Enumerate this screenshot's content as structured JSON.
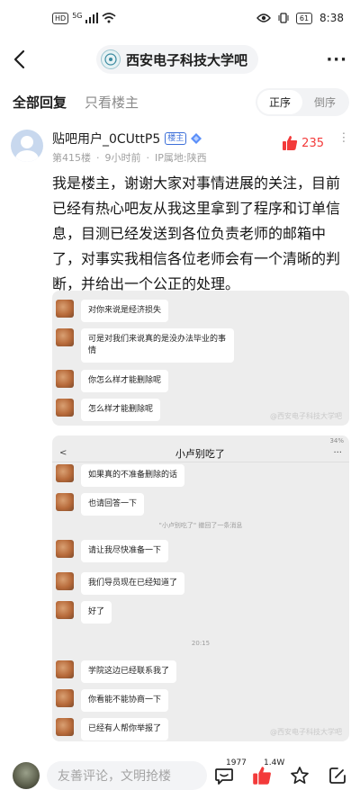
{
  "status_bar": {
    "hd": "HD",
    "net": "5G",
    "battery": "61",
    "time": "8:38"
  },
  "nav": {
    "forum_name": "西安电子科技大学吧",
    "more": "···"
  },
  "filter": {
    "all_replies": "全部回复",
    "only_op": "只看楼主",
    "order_asc": "正序",
    "order_desc": "倒序"
  },
  "post": {
    "username": "贴吧用户_0CUttP5",
    "op_badge": "楼主",
    "floor": "第415楼",
    "time": "9小时前",
    "ip": "IP属地:陕西",
    "likes": "235",
    "content": "我是楼主，谢谢大家对事情进展的关注，目前已经有热心吧友从我这里拿到了程序和订单信息，目测已经发送到各位负责老师的邮箱中了，对事实我相信各位老师会有一个清晰的判断，并给出一个公正的处理。"
  },
  "screenshot1": {
    "messages": [
      "对你来说是经济损失",
      "可是对我们来说真的是没办法毕业的事情",
      "你怎么样才能删除呢",
      "怎么样才能删除呢"
    ],
    "watermark": "@西安电子科技大学吧"
  },
  "screenshot2": {
    "status_right": "34%",
    "back": "<",
    "title": "小卢别吃了",
    "dots": "···",
    "messages_a": [
      "如果真的不准备删除的话",
      "也请回答一下"
    ],
    "system_note": "\"小卢别吃了\" 撤回了一条消息",
    "messages_b": [
      "请让我尽快准备一下",
      "我们导员现在已经知道了",
      "好了"
    ],
    "time_divider": "20:15",
    "messages_c": [
      "学院这边已经联系我了",
      "你看能不能协商一下",
      "已经有人帮你举报了"
    ],
    "watermark": "@西安电子科技大学吧"
  },
  "bottom_bar": {
    "placeholder": "友善评论，文明抢楼",
    "comment_count": "1977",
    "like_count": "1.4W"
  }
}
